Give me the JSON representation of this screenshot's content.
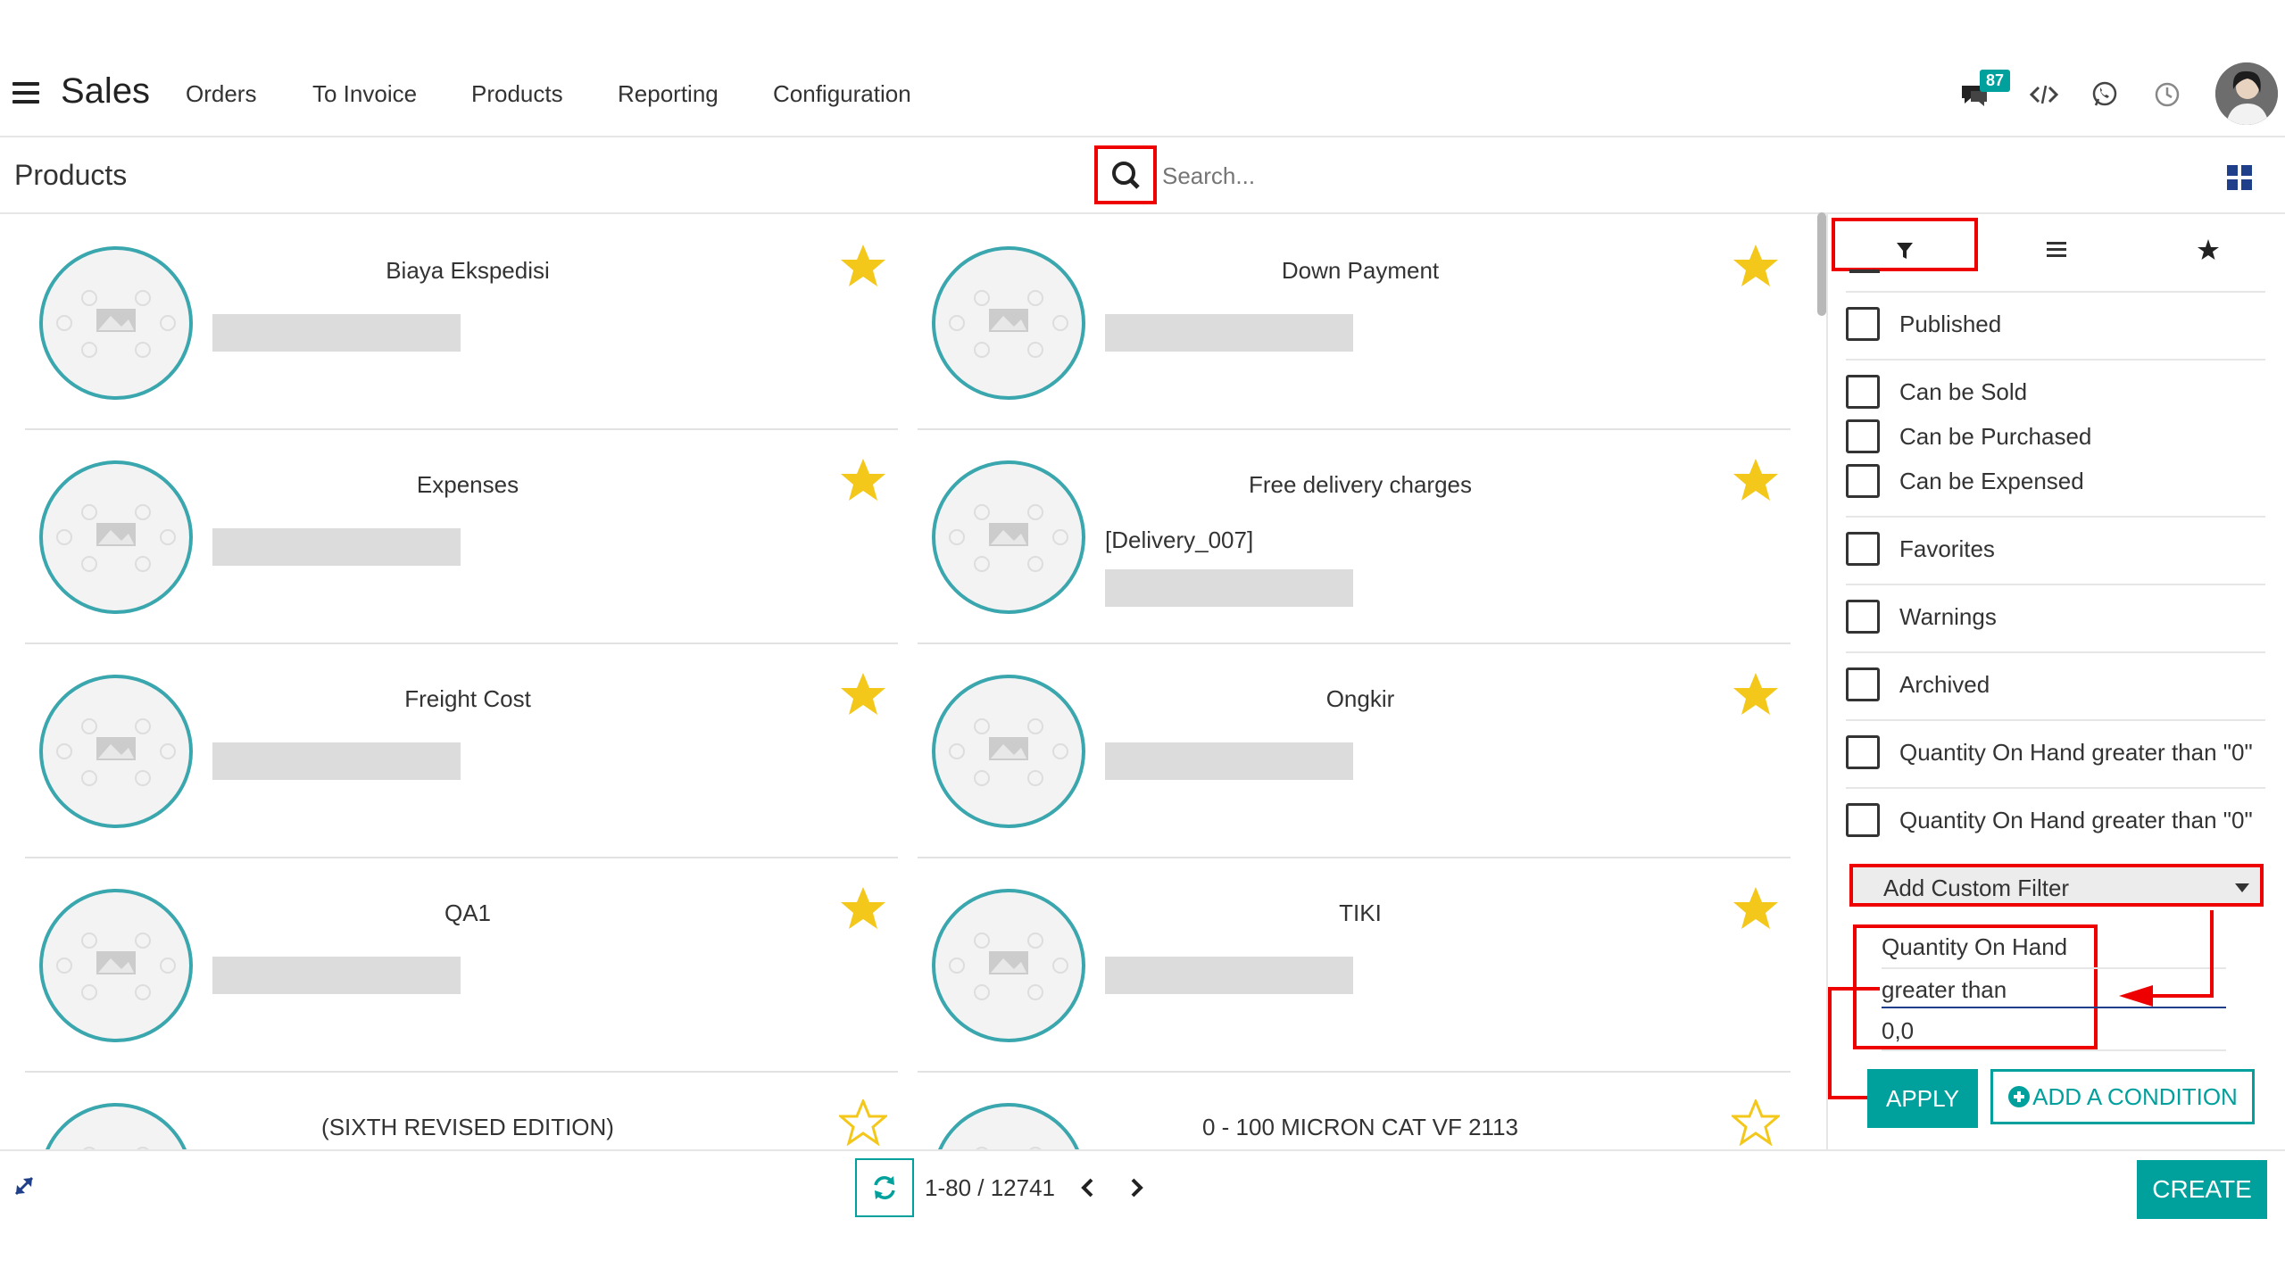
{
  "topnav": {
    "app_title": "Sales",
    "menu": [
      "Orders",
      "To Invoice",
      "Products",
      "Reporting",
      "Configuration"
    ],
    "messages_badge": "87",
    "icons": [
      "hamburger-icon",
      "chat-icon",
      "code-icon",
      "whatsapp-icon",
      "clock-icon",
      "user-avatar"
    ]
  },
  "control_panel": {
    "title": "Products",
    "search_placeholder": "Search..."
  },
  "products": [
    {
      "name": "Biaya Ekspedisi",
      "code": "",
      "favorite": true
    },
    {
      "name": "Down Payment",
      "code": "",
      "favorite": true
    },
    {
      "name": "Expenses",
      "code": "",
      "favorite": true
    },
    {
      "name": "Free delivery charges",
      "code": "[Delivery_007]",
      "favorite": true
    },
    {
      "name": "Freight Cost",
      "code": "",
      "favorite": true
    },
    {
      "name": "Ongkir",
      "code": "",
      "favorite": true
    },
    {
      "name": "QA1",
      "code": "",
      "favorite": true
    },
    {
      "name": "TIKI",
      "code": "",
      "favorite": true
    },
    {
      "name": "(SIXTH REVISED EDITION)",
      "code": "",
      "favorite": false
    },
    {
      "name": "0 - 100 MICRON CAT VF 2113",
      "code": "",
      "favorite": false
    }
  ],
  "filters": {
    "tabs": [
      "filter-icon",
      "group-by-icon",
      "favorites-icon"
    ],
    "groups": [
      [
        "Published"
      ],
      [
        "Can be Sold",
        "Can be Purchased",
        "Can be Expensed"
      ],
      [
        "Favorites"
      ],
      [
        "Warnings"
      ],
      [
        "Archived"
      ],
      [
        "Quantity On Hand greater than \"0\""
      ],
      [
        "Quantity On Hand greater than \"0\""
      ]
    ],
    "custom_filter_label": "Add Custom Filter",
    "condition": {
      "field": "Quantity On Hand",
      "operator": "greater than",
      "value": "0,0"
    },
    "apply_label": "APPLY",
    "add_condition_label": "ADD A CONDITION"
  },
  "footer": {
    "pager": "1-80 / 12741",
    "create_label": "CREATE"
  },
  "colors": {
    "primary": "#00a09d",
    "star": "#f3c81b",
    "annotation": "#e00000"
  }
}
